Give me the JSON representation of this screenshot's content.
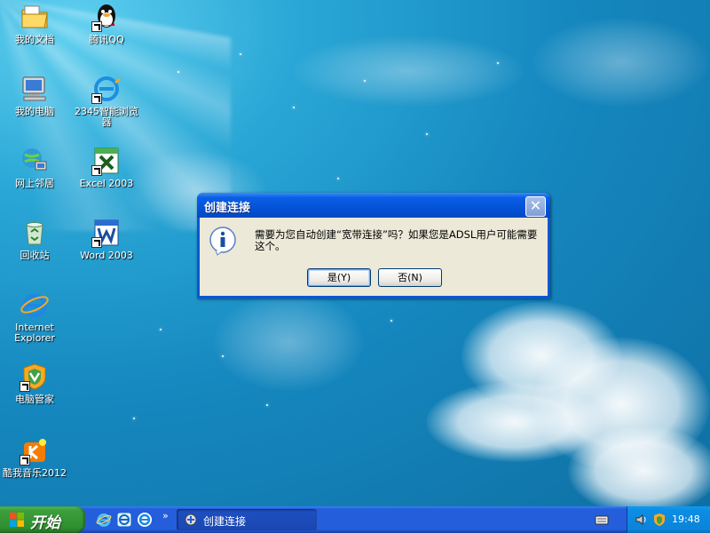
{
  "desktop": {
    "icons": [
      {
        "label": "我的文档",
        "icon": "my-documents-icon"
      },
      {
        "label": "腾讯QQ",
        "icon": "qq-penguin-icon"
      },
      {
        "label": "我的电脑",
        "icon": "my-computer-icon"
      },
      {
        "label": "2345智能浏览器",
        "icon": "browser-2345-icon"
      },
      {
        "label": "网上邻居",
        "icon": "network-places-icon"
      },
      {
        "label": "Excel 2003",
        "icon": "excel-icon"
      },
      {
        "label": "回收站",
        "icon": "recycle-bin-icon"
      },
      {
        "label": "Word 2003",
        "icon": "word-icon"
      },
      {
        "label": "Internet Explorer",
        "icon": "internet-explorer-icon"
      },
      {
        "label": "电脑管家",
        "icon": "pc-manager-shield-icon"
      },
      {
        "label": "酷我音乐2012",
        "icon": "kuwo-music-icon"
      }
    ]
  },
  "dialog": {
    "title": "创建连接",
    "message": "需要为您自动创建“宽带连接”吗？如果您是ADSL用户可能需要这个。",
    "yes_label": "是(Y)",
    "no_label": "否(N)",
    "close_glyph": "✕"
  },
  "taskbar": {
    "start_label": "开始",
    "quicklaunch_more": "»",
    "task_button_label": "创建连接",
    "clock": "19:48"
  },
  "colors": {
    "titlebar": "#0353d6",
    "taskbar": "#245edb",
    "start_button": "#3c9f3c",
    "dialog_body": "#ece9d8"
  }
}
